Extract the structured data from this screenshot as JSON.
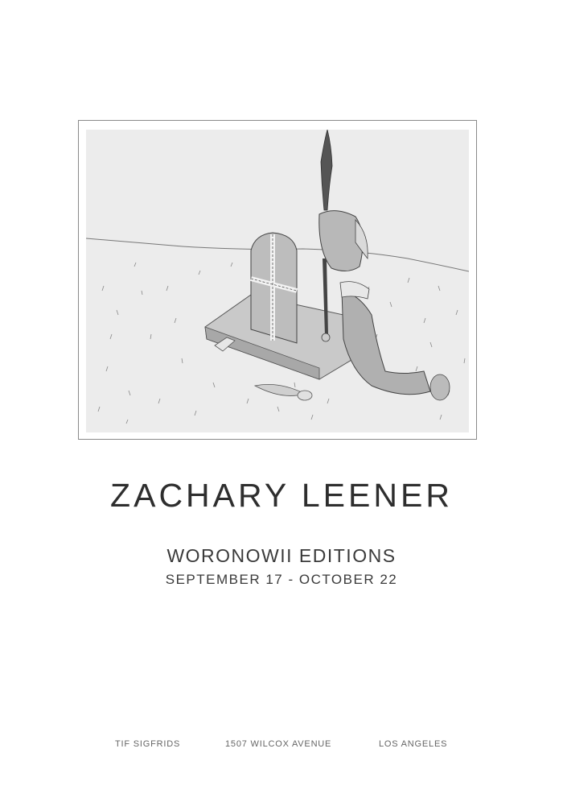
{
  "artwork": {
    "icon": "pencil-drawing-gravestone-figure"
  },
  "title": "ZACHARY LEENER",
  "subtitle": "WORONOWII EDITIONS",
  "dates": "SEPTEMBER 17 - OCTOBER 22",
  "footer": {
    "gallery": "TIF SIGFRIDS",
    "address": "1507 WILCOX AVENUE",
    "city": "LOS ANGELES"
  },
  "colors": {
    "background": "#ffffff",
    "text": "#333333",
    "artwork_paper": "#ededed",
    "frame_border": "#8a8a8a"
  }
}
